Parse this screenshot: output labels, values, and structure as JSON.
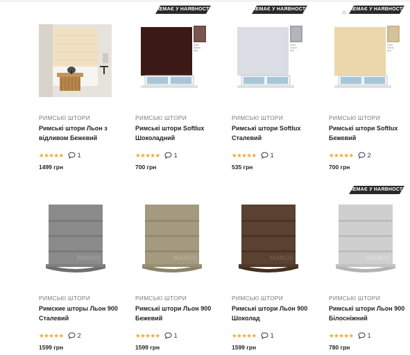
{
  "products": [
    {
      "badge": "",
      "category": "РИМСЬКІ ШТОРИ",
      "title": "Римські штори Льон з відливом Бежевий",
      "stars": "★★★★★",
      "reviews": "1",
      "price": "1499 грн",
      "image": "interior-beige-blind"
    },
    {
      "badge": "НЕМАЄ У НАЯВНОСТІ",
      "category": "РИМСЬКІ ШТОРИ",
      "title": "Римські штори Softlux Шоколадний",
      "stars": "★★★★★",
      "reviews": "1",
      "price": "700 грн",
      "image": "window-chocolate-blind"
    },
    {
      "badge": "НЕМАЄ У НАЯВНОСТІ",
      "category": "РИМСЬКІ ШТОРИ",
      "title": "Римські штори Softlux Сталевий",
      "stars": "★★★★★",
      "reviews": "1",
      "price": "535 грн",
      "image": "window-steel-blind"
    },
    {
      "badge": "НЕМАЄ У НАЯВНОСТІ",
      "category": "РИМСЬКІ ШТОРИ",
      "title": "Римські штори Softlux Бежевий",
      "stars": "★★★★★",
      "reviews": "2",
      "price": "700 грн",
      "image": "window-beige-blind"
    },
    {
      "badge": "",
      "category": "РИМСЬКІ ШТОРИ",
      "title": "Римские шторы Льон 900 Сталевий",
      "stars": "★★★★★",
      "reviews": "2",
      "price": "1599 грн",
      "image": "folded-gray-blind"
    },
    {
      "badge": "",
      "category": "РИМСЬКІ ШТОРИ",
      "title": "Римські штори Льон 900 Бежевий",
      "stars": "★★★★★",
      "reviews": "1",
      "price": "1599 грн",
      "image": "folded-beige-blind"
    },
    {
      "badge": "",
      "category": "РИМСЬКІ ШТОРИ",
      "title": "Римські штори Льон 900 Шоколад",
      "stars": "★★★★★",
      "reviews": "1",
      "price": "1599 грн",
      "image": "folded-brown-blind"
    },
    {
      "badge": "НЕМАЄ У НАЯВНОСТІ",
      "category": "РИМСЬКІ ШТОРИ",
      "title": "Римські штори Льон 900 Білосніжний",
      "stars": "★★★★★",
      "reviews": "1",
      "price": "780 грн",
      "image": "folded-white-blind"
    }
  ],
  "colors": {
    "badge": "#2a2a2a",
    "star": "#f5a623",
    "chocolate": "#3b1a16",
    "steel": "#dadde3",
    "beige": "#ecd7ab",
    "linen_gray": "#8b8b8b",
    "linen_beige": "#a39a7f",
    "linen_brown": "#5a4131",
    "linen_white": "#cfcfcf"
  }
}
